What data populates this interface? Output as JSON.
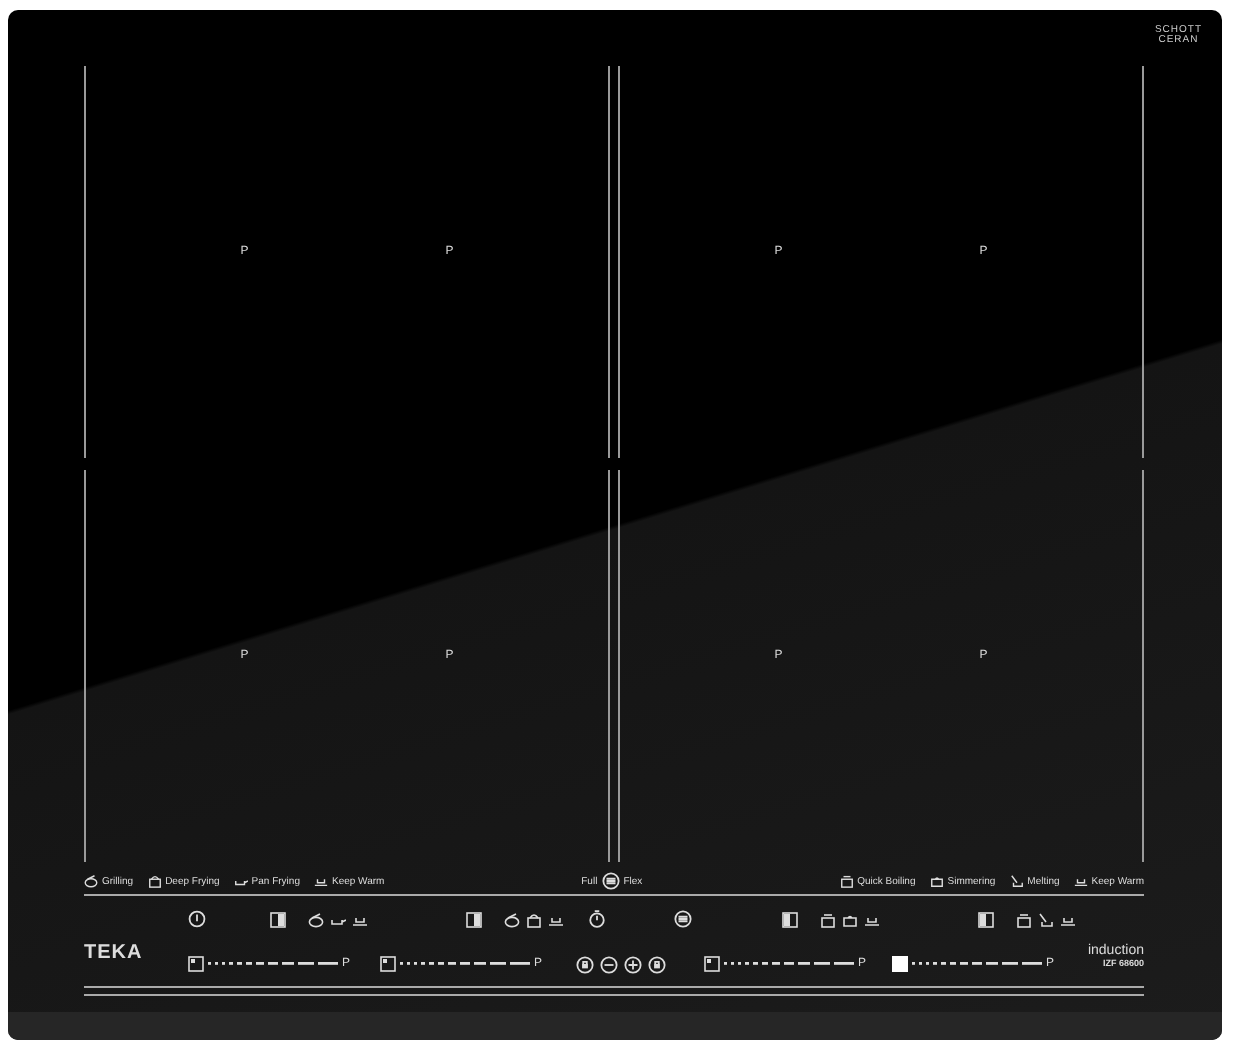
{
  "badge": {
    "line1": "SCHOTT",
    "line2": "CERAN"
  },
  "zones": [
    {
      "marks": [
        "P",
        "P"
      ]
    },
    {
      "marks": [
        "P",
        "P"
      ]
    },
    {
      "marks": [
        "P",
        "P"
      ]
    },
    {
      "marks": [
        "P",
        "P"
      ]
    }
  ],
  "functions_left": [
    {
      "label": "Grilling"
    },
    {
      "label": "Deep Frying"
    },
    {
      "label": "Pan Frying"
    },
    {
      "label": "Keep Warm"
    }
  ],
  "mode": {
    "left": "Full",
    "right": "Flex"
  },
  "functions_right": [
    {
      "label": "Quick Boiling"
    },
    {
      "label": "Simmering"
    },
    {
      "label": "Melting"
    },
    {
      "label": "Keep Warm"
    }
  ],
  "sliders": [
    {
      "end_label": "P",
      "selected": false
    },
    {
      "end_label": "P",
      "selected": false
    },
    {
      "end_label": "P",
      "selected": false
    },
    {
      "end_label": "P",
      "selected": true
    }
  ],
  "brand": "TEKA",
  "product": {
    "type": "induction",
    "model": "IZF 68600"
  }
}
